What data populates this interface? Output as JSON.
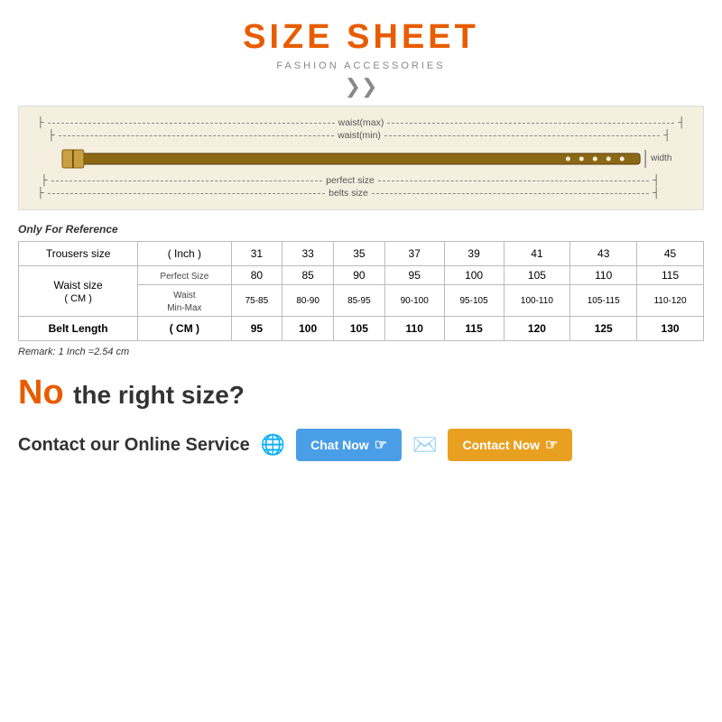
{
  "title": "SIZE SHEET",
  "subtitle": "FASHION ACCESSORIES",
  "belt_diagram": {
    "rows": [
      {
        "label": "waist(max)",
        "side": "right"
      },
      {
        "label": "waist(min)",
        "side": "right"
      },
      {
        "label": "perfect size",
        "side": "right"
      },
      {
        "label": "belts size",
        "side": "right"
      }
    ],
    "width_label": "width"
  },
  "ref_note": "Only For Reference",
  "table": {
    "header_row": [
      "Trousers size",
      "( Inch )",
      "31",
      "33",
      "35",
      "37",
      "39",
      "41",
      "43",
      "45"
    ],
    "waist_label": "Waist size\n( CM )",
    "perfect_size_label": "Perfect Size",
    "perfect_size_values": [
      "80",
      "85",
      "90",
      "95",
      "100",
      "105",
      "110",
      "115"
    ],
    "waist_minmax_label": "Waist\nMin-Max",
    "waist_minmax_values": [
      "75-85",
      "80-90",
      "85-95",
      "90-100",
      "95-105",
      "100-110",
      "105-115",
      "110-120"
    ],
    "belt_length_label": "Belt Length",
    "belt_length_unit": "( CM )",
    "belt_length_values": [
      "95",
      "100",
      "105",
      "110",
      "115",
      "120",
      "125",
      "130"
    ]
  },
  "remark": "Remark: 1 Inch =2.54 cm",
  "no_text": "No",
  "no_rest": "the right size?",
  "contact_label": "Contact our Online Service",
  "chat_now": "Chat Now",
  "contact_now": "Contact Now"
}
